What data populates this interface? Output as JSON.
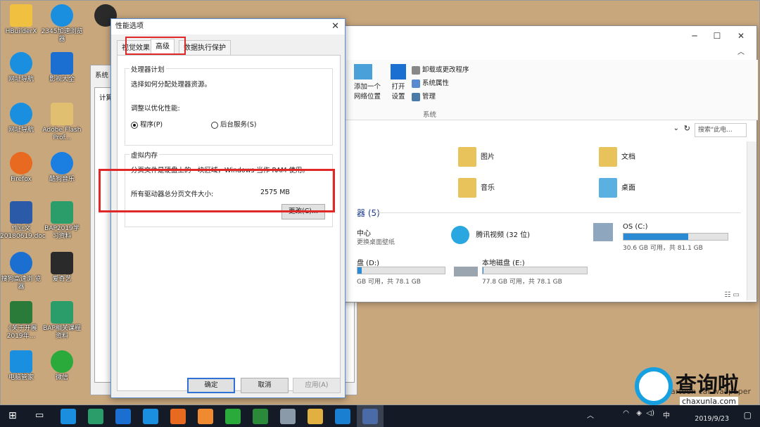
{
  "desktop": {
    "photo_label": "cartoon cat wallpaper",
    "icons": [
      {
        "label": "HBuilderX",
        "color": "#f0c040"
      },
      {
        "label": "2345加速浏览器",
        "color": "#1a8fe0"
      },
      {
        "label": "网址导航",
        "color": "#1a8fe0"
      },
      {
        "label": "影视大全",
        "color": "#1a6fd0"
      },
      {
        "label": "网址导航",
        "color": "#1a8fe0"
      },
      {
        "label": "Adobe Flash Prof...",
        "color": "#e0c070"
      },
      {
        "label": "Firefox",
        "color": "#e86a20"
      },
      {
        "label": "酷狗音乐",
        "color": "#1a7fe0"
      },
      {
        "label": "作业文 20180619.doc",
        "color": "#2a5aa8"
      },
      {
        "label": "BAP2019学 习资料",
        "color": "#2a9d6a"
      },
      {
        "label": "搜狗高速浏 览器",
        "color": "#1a6fd0"
      },
      {
        "label": "爱奇艺",
        "color": "#2a2a2a"
      },
      {
        "label": "《关于开展 2019年...",
        "color": "#2a7a3a"
      },
      {
        "label": "BAP相关课程 资料",
        "color": "#2a9d6a"
      },
      {
        "label": "电脑管家",
        "color": "#1a8fe0"
      },
      {
        "label": "微信",
        "color": "#2aaa3a"
      }
    ]
  },
  "explorer": {
    "ribbon": {
      "add_label_1": "添加一个",
      "add_label_2": "网络位置",
      "open_label_1": "打开",
      "open_label_2": "设置",
      "uninstall": "卸载或更改程序",
      "sys_props": "系统属性",
      "manage": "管理",
      "group_system": "系统"
    },
    "search_placeholder": "搜索\"此电...",
    "folders": [
      "图片",
      "文档",
      "音乐",
      "桌面"
    ],
    "devices_header": "器 (5)",
    "media_center_1": "中心",
    "media_center_2": "更换桌面壁纸",
    "tencent_video": "腾讯视频 (32 位)",
    "drives": [
      {
        "name": "OS (C:)",
        "info": "30.6 GB 可用，共 81.1 GB",
        "used": 0.62
      },
      {
        "name": "盘 (D:)",
        "info": "GB 可用，共 78.1 GB",
        "used": 0.05
      },
      {
        "name": "本地磁盘 (E:)",
        "info": "77.8 GB 可用，共 78.1 GB",
        "used": 0.004
      }
    ]
  },
  "dialog": {
    "title": "性能选项",
    "tabs": [
      "视觉效果",
      "高级",
      "数据执行保护"
    ],
    "cpu_group": "处理器计划",
    "cpu_desc": "选择如何分配处理器资源。",
    "optimize_label": "调整以优化性能:",
    "radio_programs": "程序(P)",
    "radio_services": "后台服务(S)",
    "vm_group": "虚拟内存",
    "vm_desc": "分页文件是硬盘上的一块区域，Windows 当作 RAM 使用。",
    "vm_total_label": "所有驱动器总分页文件大小:",
    "vm_total_value": "2575 MB",
    "change_button": "更改(C)...",
    "ok": "确定",
    "cancel": "取消",
    "apply": "应用(A)"
  },
  "bg_window": {
    "title": "系统",
    "tab": "计算"
  },
  "taskbar": {
    "date": "2019/9/23",
    "time": "",
    "ime": "中",
    "app_colors": [
      "#1a8fe0",
      "#2a9d6a",
      "#1a6fd0",
      "#1a8fe0",
      "#e86a20",
      "#f08a30",
      "#2aaa3a",
      "#2a8a3a",
      "#8a9aa8",
      "#e0b040",
      "#1a7fd0",
      "#4a6aa8"
    ]
  },
  "watermark": {
    "main": "查询啦",
    "sub": "chaxunla.com"
  }
}
